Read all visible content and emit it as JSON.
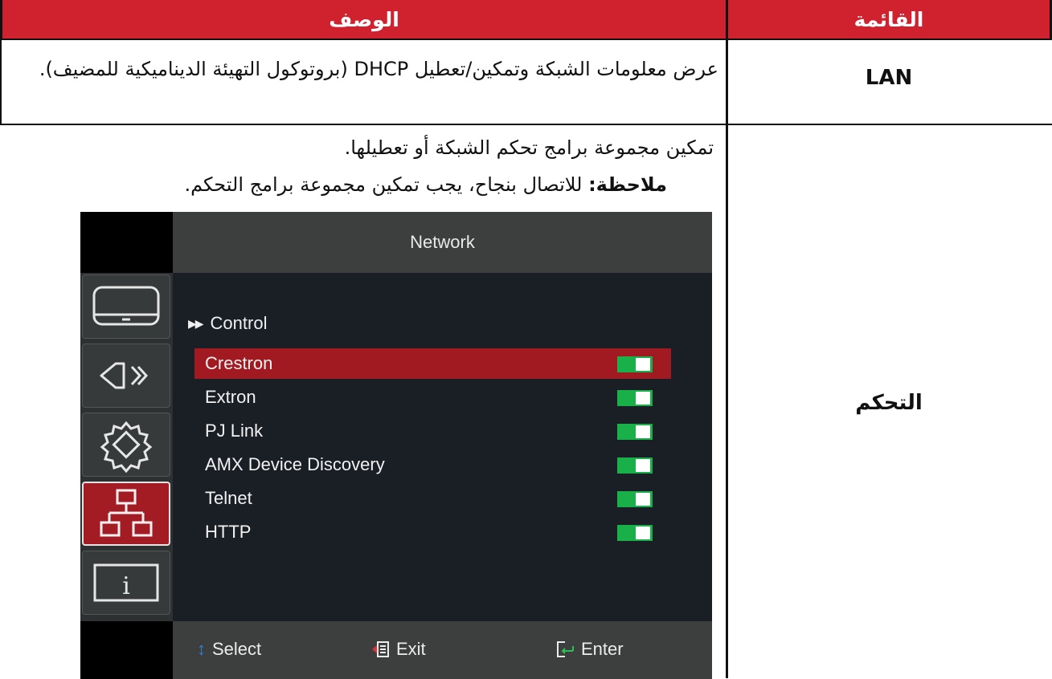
{
  "header": {
    "menu_col": "القائمة",
    "desc_col": "الوصف"
  },
  "colors": {
    "header_bg": "#d0212f",
    "toggle_on": "#19b04a",
    "selected_row": "#a11a21"
  },
  "rows": [
    {
      "menu": "LAN",
      "description": "عرض معلومات الشبكة وتمكين/تعطيل DHCP (بروتوكول التهيئة الديناميكية للمضيف)."
    },
    {
      "menu": "التحكم",
      "description": "تمكين مجموعة برامج تحكم الشبكة أو تعطيلها.",
      "note_label": "ملاحظة:",
      "note_text": " للاتصال بنجاح، يجب تمكين مجموعة برامج التحكم."
    }
  ],
  "osd": {
    "title": "Network",
    "section_icon": "double-play-icon",
    "section_label": "Control",
    "sidebar_icons": [
      "display-icon",
      "audio-icon",
      "settings-gear-icon",
      "network-icon",
      "info-icon"
    ],
    "active_sidebar": 3,
    "items": [
      {
        "label": "Crestron",
        "on": true,
        "selected": true
      },
      {
        "label": "Extron",
        "on": true
      },
      {
        "label": "PJ Link",
        "on": true
      },
      {
        "label": "AMX Device Discovery",
        "on": true
      },
      {
        "label": "Telnet",
        "on": true
      },
      {
        "label": "HTTP",
        "on": true
      }
    ],
    "footer": {
      "select": "Select",
      "exit": "Exit",
      "enter": "Enter"
    }
  }
}
